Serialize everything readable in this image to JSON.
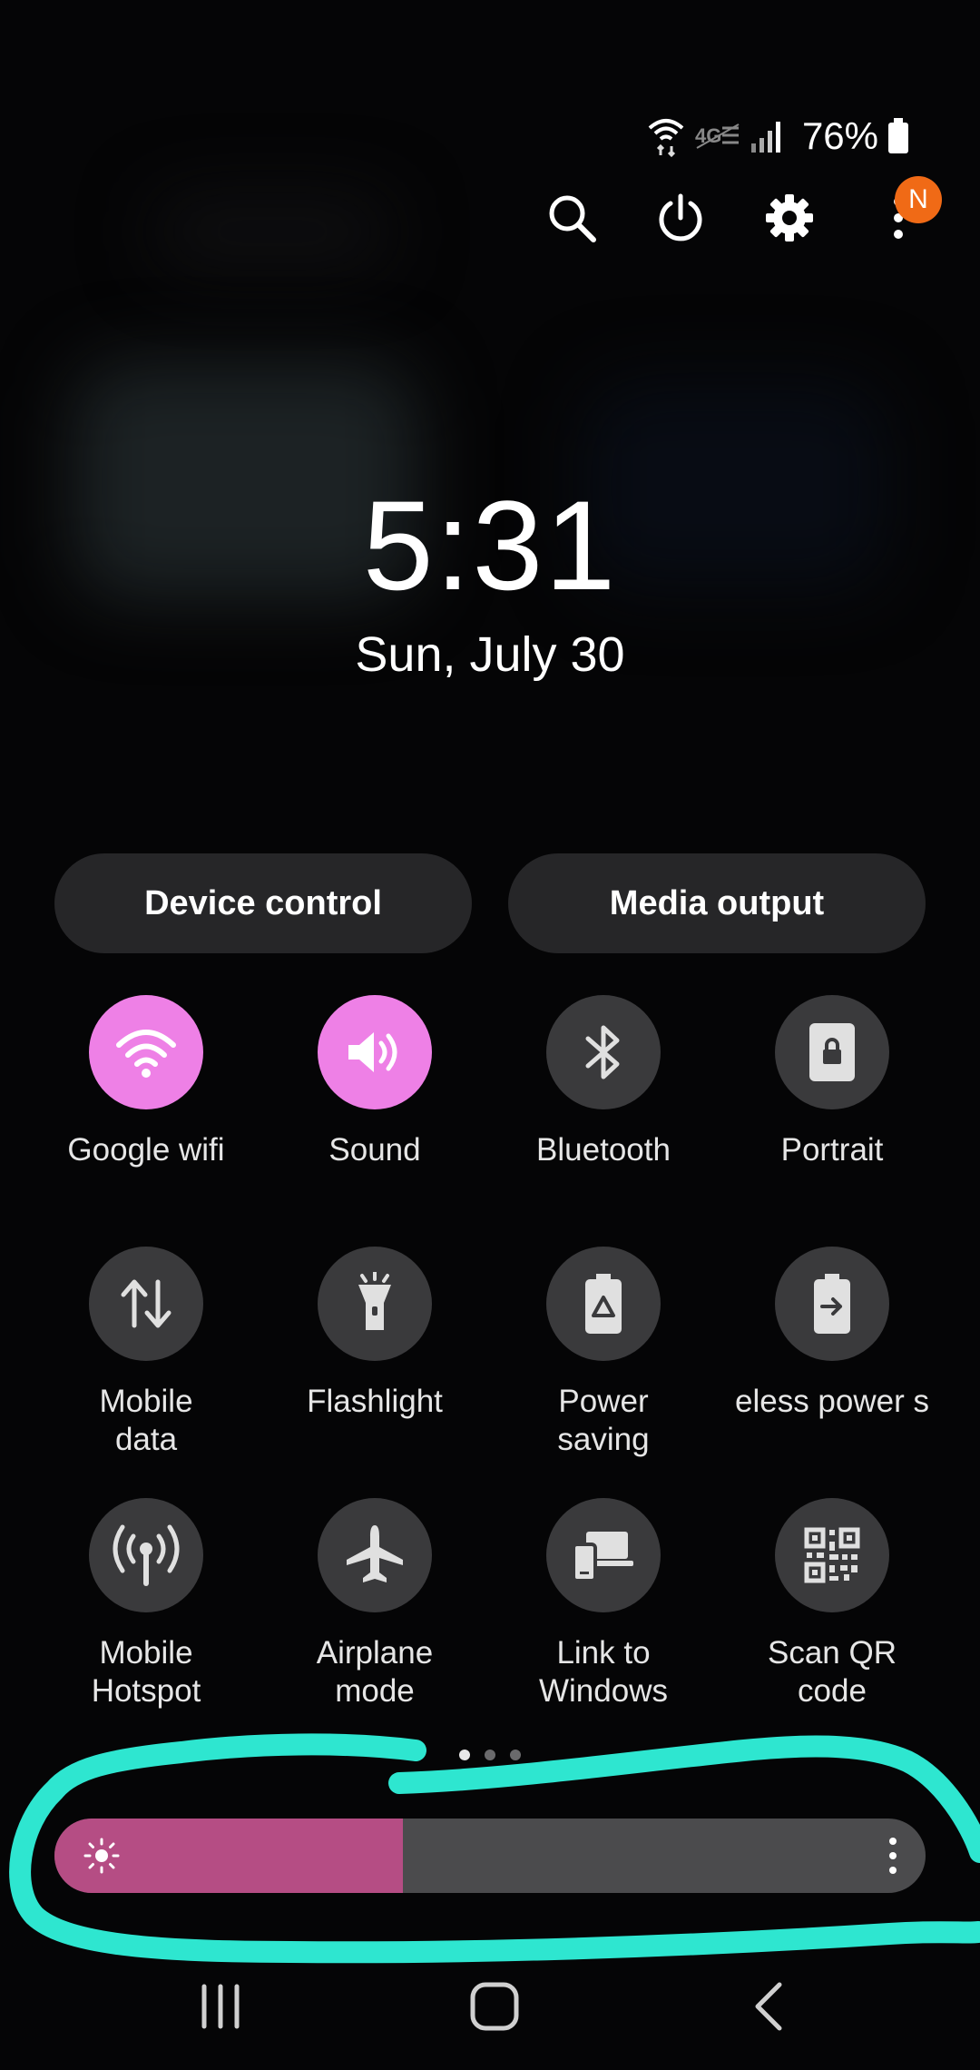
{
  "status_bar": {
    "battery_percent": "76%",
    "wifi_icon": "wifi-data-icon",
    "network_icon": "4g-disabled-icon",
    "signal_icon": "signal-icon",
    "battery_icon": "battery-icon"
  },
  "top_actions": {
    "search_icon": "search-icon",
    "power_icon": "power-icon",
    "settings_icon": "gear-icon",
    "more_icon": "more-vertical-icon",
    "notification_badge": "N"
  },
  "clock": {
    "time": "5:31",
    "date": "Sun, July 30"
  },
  "buttons": {
    "device_control": "Device control",
    "media_output": "Media output"
  },
  "tiles": [
    {
      "label": "Google wifi",
      "icon": "wifi-icon",
      "active": true
    },
    {
      "label": "Sound",
      "icon": "speaker-icon",
      "active": true
    },
    {
      "label": "Bluetooth",
      "icon": "bluetooth-icon",
      "active": false
    },
    {
      "label": "Portrait",
      "icon": "rotation-lock-icon",
      "active": false
    },
    {
      "label": "Mobile\ndata",
      "icon": "data-arrows-icon",
      "active": false
    },
    {
      "label": "Flashlight",
      "icon": "flashlight-icon",
      "active": false
    },
    {
      "label": "Power\nsaving",
      "icon": "power-saving-icon",
      "active": false
    },
    {
      "label": "eless power s",
      "icon": "wireless-powershare-icon",
      "active": false
    },
    {
      "label": "Mobile\nHotspot",
      "icon": "hotspot-icon",
      "active": false
    },
    {
      "label": "Airplane\nmode",
      "icon": "airplane-icon",
      "active": false
    },
    {
      "label": "Link to\nWindows",
      "icon": "link-to-windows-icon",
      "active": false
    },
    {
      "label": "Scan QR\ncode",
      "icon": "qr-code-icon",
      "active": false
    }
  ],
  "page_indicator": {
    "pages": 3,
    "current": 1
  },
  "brightness": {
    "level": 0.4,
    "icon": "sun-icon",
    "fill_color": "#b54d84"
  },
  "colors": {
    "accent": "#ee80e6",
    "annotation": "#2ee6d0"
  },
  "nav": {
    "recents_icon": "recents-icon",
    "home_icon": "home-icon",
    "back_icon": "back-icon"
  }
}
